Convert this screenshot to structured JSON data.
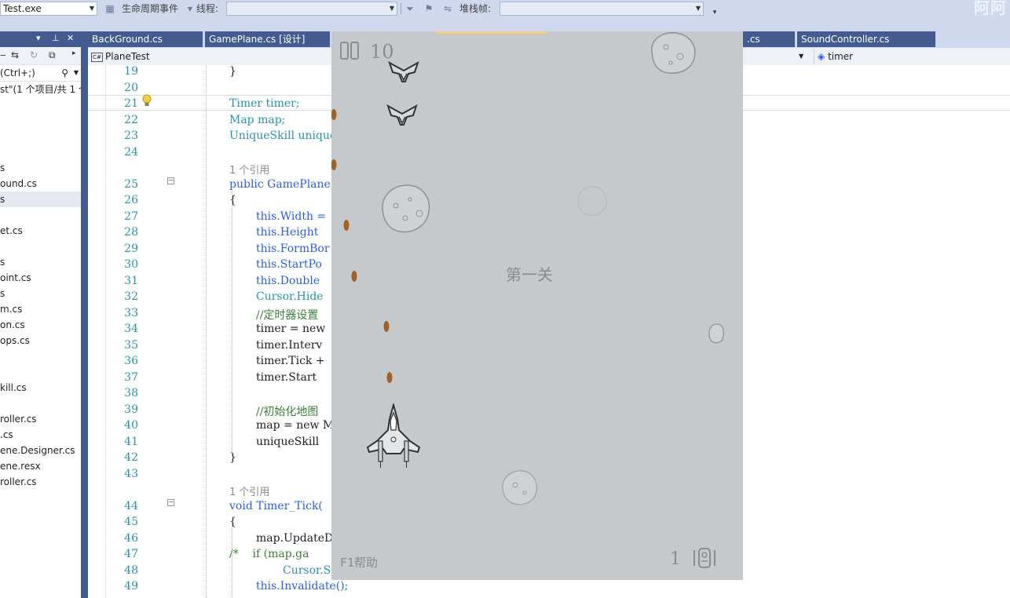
{
  "toolbar": {
    "process_combo": "Test.exe",
    "lifecycle_label": "生命周期事件",
    "thread_label": "线程:",
    "stack_frame_label": "堆栈帧:",
    "brand_text": "阿阿"
  },
  "solution_explorer": {
    "search_placeholder": "(Ctrl+;)",
    "summary": "st\"(1 个项目/共 1 个",
    "items": [
      "",
      "",
      "",
      "",
      "s",
      "ound.cs",
      "s",
      "",
      "et.cs",
      "",
      "s",
      "oint.cs",
      "s",
      "m.cs",
      "on.cs",
      "ops.cs",
      "",
      "",
      "kill.cs",
      "",
      "roller.cs",
      ".cs",
      "ene.Designer.cs",
      "ene.resx",
      "roller.cs"
    ],
    "selected_index": 6
  },
  "tabs": [
    {
      "label": "BackGround.cs"
    },
    {
      "label": "GamePlane.cs [设计]"
    },
    {
      "label": ""
    },
    {
      "label": ".cs"
    },
    {
      "label": "SoundController.cs"
    }
  ],
  "navbar": {
    "left_combo": "PlaneTest",
    "right_combo": "timer"
  },
  "code": {
    "lines": [
      {
        "n": "19",
        "t": "}",
        "indent": 1
      },
      {
        "n": "20",
        "t": "",
        "indent": 0
      },
      {
        "n": "21",
        "t": "Timer timer;",
        "indent": 1
      },
      {
        "n": "22",
        "t": "Map map;",
        "indent": 1
      },
      {
        "n": "23",
        "t": "UniqueSkill unique",
        "indent": 1
      },
      {
        "n": "24",
        "t": "",
        "indent": 0
      },
      {
        "n": "",
        "t": "1 个引用",
        "indent": 1,
        "ref": true
      },
      {
        "n": "25",
        "t": "public GamePlane(",
        "indent": 1
      },
      {
        "n": "26",
        "t": "{",
        "indent": 1
      },
      {
        "n": "27",
        "t": "this.Width =",
        "indent": 2
      },
      {
        "n": "28",
        "t": "this.Height",
        "indent": 2
      },
      {
        "n": "29",
        "t": "this.FormBor",
        "indent": 2
      },
      {
        "n": "30",
        "t": "this.StartPo",
        "indent": 2
      },
      {
        "n": "31",
        "t": "this.Double",
        "indent": 2
      },
      {
        "n": "32",
        "t": "Cursor.Hide",
        "indent": 2
      },
      {
        "n": "33",
        "t": "//定时器设置",
        "indent": 2
      },
      {
        "n": "34",
        "t": "timer = new",
        "indent": 2
      },
      {
        "n": "35",
        "t": "timer.Interv",
        "indent": 2
      },
      {
        "n": "36",
        "t": "timer.Tick +",
        "indent": 2
      },
      {
        "n": "37",
        "t": "timer.Start",
        "indent": 2
      },
      {
        "n": "38",
        "t": "",
        "indent": 0
      },
      {
        "n": "39",
        "t": "//初始化地图",
        "indent": 2
      },
      {
        "n": "40",
        "t": "map = new Ma",
        "indent": 2
      },
      {
        "n": "41",
        "t": "uniqueSkill",
        "indent": 2
      },
      {
        "n": "42",
        "t": "}",
        "indent": 1
      },
      {
        "n": "43",
        "t": "",
        "indent": 0
      },
      {
        "n": "",
        "t": "1 个引用",
        "indent": 1,
        "ref": true
      },
      {
        "n": "44",
        "t": "void Timer_Tick(",
        "indent": 1
      },
      {
        "n": "45",
        "t": "{",
        "indent": 1
      },
      {
        "n": "46",
        "t": "map.UpdateDa",
        "indent": 2
      },
      {
        "n": "47",
        "t": "/*    if (map.ga",
        "indent": 1
      },
      {
        "n": "48",
        "t": "Cursor.S",
        "indent": 3
      },
      {
        "n": "49",
        "t": "this.Invalidate();",
        "indent": 2
      }
    ]
  },
  "game": {
    "score": "10",
    "level_text": "第一关",
    "help_text": "F1帮助",
    "bomb_count": "1",
    "colors": {
      "background": "#c5c9cc",
      "bullet": "#a0622a",
      "text": "#8c8c8c"
    }
  }
}
